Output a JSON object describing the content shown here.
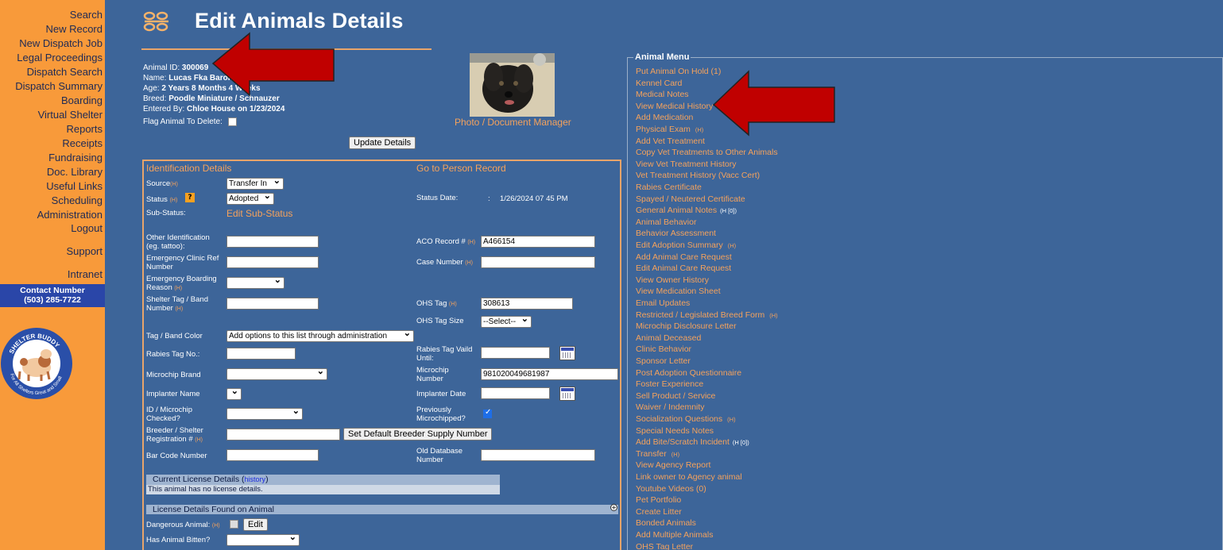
{
  "sidebar": {
    "items": [
      "Search",
      "New Record",
      "New Dispatch Job",
      "Legal Proceedings",
      "Dispatch Search",
      "Dispatch Summary",
      "Boarding",
      "Virtual Shelter",
      "Reports",
      "Receipts",
      "Fundraising",
      "Doc. Library",
      "Useful Links",
      "Scheduling",
      "Administration",
      "Logout",
      "Support",
      "Intranet"
    ],
    "contact_label": "Contact Number",
    "contact_number": "(503) 285-7722",
    "logo_text": "SHELTER BUDDY",
    "logo_subtext": "For All Shelters Great and Small"
  },
  "header": {
    "title": "Edit Animals Details"
  },
  "summary": {
    "animal_id_label": "Animal ID:",
    "animal_id": "300069",
    "name_label": "Name:",
    "name": "Lucas Fka Baron",
    "age_label": "Age:",
    "age": "2 Years 8 Months 4 Weeks",
    "breed_label": "Breed:",
    "breed": "Poodle Miniature / Schnauzer",
    "entered_label": "Entered By:",
    "entered": "Chloe House on 1/23/2024",
    "flag_label": "Flag Animal To Delete:"
  },
  "photo_link": "Photo / Document Manager",
  "update_button": "Update Details",
  "form": {
    "identification_title": "Identification Details",
    "person_link": "Go to Person Record",
    "source_label": "Source",
    "source_value": "Transfer In",
    "status_label": "Status",
    "status_value": "Adopted",
    "status_help": "?",
    "status_date_label": "Status Date:",
    "status_date_sep": ":",
    "status_date": "1/26/2024 07 45 PM",
    "substatus_label": "Sub-Status:",
    "substatus_link": "Edit Sub-Status",
    "other_id_label": "Other Identification (eg. tattoo):",
    "aco_label": "ACO Record #",
    "aco_value": "A466154",
    "emergency_ref_label": "Emergency Clinic Ref Number",
    "case_label": "Case Number",
    "emergency_board_label": "Emergency Boarding Reason",
    "shelter_tag_label": "Shelter Tag / Band Number",
    "ohs_tag_label": "OHS Tag",
    "ohs_tag_value": "308613",
    "ohs_size_label": "OHS Tag Size",
    "ohs_size_value": "--Select--",
    "tag_color_label": "Tag / Band Color",
    "tag_color_value": "Add options to this list through administration",
    "rabies_tag_label": "Rabies Tag No.:",
    "rabies_valid_label": "Rabies Tag Vaild Until:",
    "microchip_brand_label": "Microchip Brand",
    "microchip_number_label": "Microchip Number",
    "microchip_number": "981020049681987",
    "implanter_name_label": "Implanter Name",
    "implanter_date_label": "Implanter Date",
    "id_checked_label": "ID / Microchip Checked?",
    "prev_chipped_label": "Previously Microchipped?",
    "breeder_label": "Breeder / Shelter Registration #",
    "breeder_button": "Set Default Breeder Supply Number",
    "barcode_label": "Bar Code Number",
    "old_db_label": "Old Database Number",
    "license_title": "Current License Details (",
    "license_link": "history",
    "license_close": ")",
    "license_none": "This animal has no license details.",
    "license_found_title": "License Details Found on Animal",
    "dangerous_label": "Dangerous Animal:",
    "edit_button": "Edit",
    "bitten_label": "Has Animal Bitten?",
    "h_tag": "(H)"
  },
  "animal_menu": {
    "title": "Animal Menu",
    "items": [
      {
        "label": "Put Animal On Hold (1)"
      },
      {
        "label": "Kennel Card"
      },
      {
        "label": "Medical Notes"
      },
      {
        "label": "View Medical History"
      },
      {
        "label": "Add Medication"
      },
      {
        "label": "Physical Exam",
        "tag": "(H)"
      },
      {
        "label": "Add Vet Treatment"
      },
      {
        "label": "Copy Vet Treatments to Other Animals"
      },
      {
        "label": "View Vet Treatment History"
      },
      {
        "label": "Vet Treatment History (Vacc Cert)"
      },
      {
        "label": "Rabies Certificate"
      },
      {
        "label": "Spayed / Neutered Certificate"
      },
      {
        "label": "General Animal Notes",
        "wtag": "(H [0])"
      },
      {
        "label": "Animal Behavior"
      },
      {
        "label": "Behavior Assessment"
      },
      {
        "label": "Edit Adoption Summary",
        "tag": "(H)"
      },
      {
        "label": "Add Animal Care Request"
      },
      {
        "label": "Edit Animal Care Request"
      },
      {
        "label": "View Owner History"
      },
      {
        "label": "View Medication Sheet"
      },
      {
        "label": "Email Updates"
      },
      {
        "label": "Restricted / Legislated Breed Form",
        "tag": "(H)"
      },
      {
        "label": "Microchip Disclosure Letter"
      },
      {
        "label": "Animal Deceased"
      },
      {
        "label": "Clinic Behavior"
      },
      {
        "label": "Sponsor Letter"
      },
      {
        "label": "Post Adoption Questionnaire"
      },
      {
        "label": "Foster Experience"
      },
      {
        "label": "Sell Product / Service"
      },
      {
        "label": "Waiver / Indemnity"
      },
      {
        "label": "Socialization Questions",
        "tag": "(H)"
      },
      {
        "label": "Special Needs Notes"
      },
      {
        "label": "Add Bite/Scratch Incident",
        "wtag": "(H [0])"
      },
      {
        "label": "Transfer",
        "tag": "(H)"
      },
      {
        "label": "View Agency Report"
      },
      {
        "label": "Link owner to Agency animal"
      },
      {
        "label": "Youtube Videos (0)"
      },
      {
        "label": "Pet Portfolio"
      },
      {
        "label": "Create Litter"
      },
      {
        "label": "Bonded Animals"
      },
      {
        "label": "Add Multiple Animals"
      },
      {
        "label": "OHS Tag Letter"
      }
    ]
  },
  "colors": {
    "background": "#3d6599",
    "sidebar": "#f89a3a",
    "accent": "#f5a25c",
    "arrow": "#c00000"
  }
}
